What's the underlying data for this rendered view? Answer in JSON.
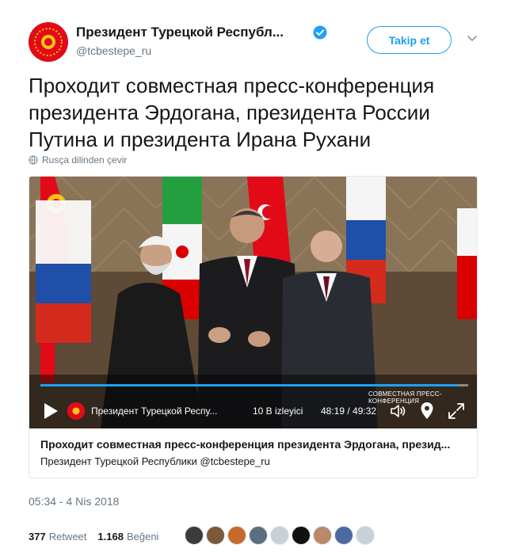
{
  "account": {
    "display_name": "Президент Турецкой Республ...",
    "handle": "@tcbestepe_ru",
    "verified": true,
    "avatar_color": "#e30a17"
  },
  "header": {
    "follow_label": "Takip et",
    "accent_color": "#1da1f2"
  },
  "tweet": {
    "text": "Проходит совместная пресс-конференция президента Эрдогана, президента России Путина и президента Ирана Рухани",
    "translate_label": "Rusça dilinden çevir"
  },
  "video": {
    "banner": "СОВМЕСТНАЯ ПРЕСС-КОНФЕРЕНЦИЯ",
    "channel": "Президент Турецкой Респу...",
    "views": "10 B izleyici",
    "time": "48:19 / 49:32",
    "progress": 0.975,
    "icons": [
      "play-icon",
      "volume-icon",
      "pin-icon",
      "fullscreen-icon"
    ]
  },
  "card": {
    "title": "Проходит совместная пресс-конференция президента Эрдогана, презид...",
    "subtitle": "Президент Турецкой Республики @tcbestepe_ru"
  },
  "meta": {
    "timestamp": "05:34 - 4 Nis 2018"
  },
  "stats": {
    "retweets": "377",
    "retweets_label": "Retweet",
    "likes": "1.168",
    "likes_label": "Beğeni",
    "liker_colors": [
      "#3b3b3b",
      "#7a5a3a",
      "#c46a2c",
      "#5c6f82",
      "#c8d0d8",
      "#111111",
      "#b98a6a",
      "#4d6aa0",
      "#c8d0d8"
    ]
  }
}
